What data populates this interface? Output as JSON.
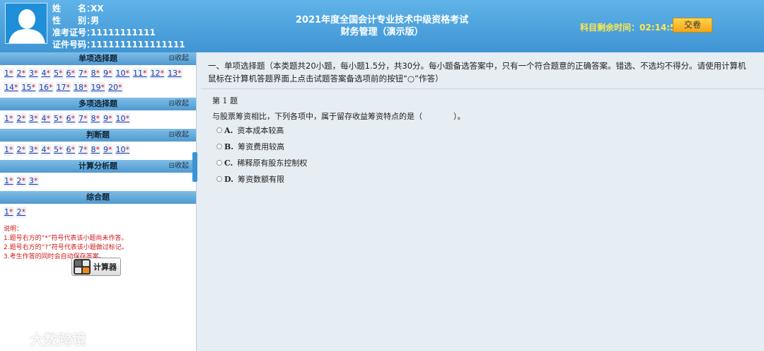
{
  "candidate": {
    "name_label": "姓　　名：",
    "name": "XX",
    "gender_label": "性　　别：",
    "gender": "男",
    "ticket_label": "准考证号：",
    "ticket": "11111111111",
    "id_label": "证件号码：",
    "id": "1111111111111111"
  },
  "exam": {
    "title": "2021年度全国会计专业技术中级资格考试",
    "subject": "财务管理（演示版）"
  },
  "timer": {
    "label": "科目剩余时间：",
    "value": "02:14:51"
  },
  "submit_label": "交卷",
  "sections": [
    {
      "title": "单项选择题",
      "collapse": "收起",
      "questions": [
        "1",
        "2",
        "3",
        "4",
        "5",
        "6",
        "7",
        "8",
        "9",
        "10",
        "11",
        "12",
        "13",
        "14",
        "15",
        "16",
        "17",
        "18",
        "19",
        "20"
      ]
    },
    {
      "title": "多项选择题",
      "collapse": "收起",
      "questions": [
        "1",
        "2",
        "3",
        "4",
        "5",
        "6",
        "7",
        "8",
        "9",
        "10"
      ]
    },
    {
      "title": "判断题",
      "collapse": "收起",
      "questions": [
        "1",
        "2",
        "3",
        "4",
        "5",
        "6",
        "7",
        "8",
        "9",
        "10"
      ]
    },
    {
      "title": "计算分析题",
      "collapse": "收起",
      "questions": [
        "1",
        "2",
        "3"
      ]
    },
    {
      "title": "综合题",
      "collapse": "",
      "questions": [
        "1",
        "2"
      ]
    }
  ],
  "star_mark": "*",
  "notes": {
    "title": "说明：",
    "lines": [
      "1.题号右方的“*”符号代表该小题尚未作答。",
      "2.题号右方的“?”符号代表该小题做过标记。",
      "3.考生作答的同时会自动保存答案。"
    ]
  },
  "calculator_label": "计算器",
  "watermark": "大数跨境",
  "instructions": "一、单项选择题（本类题共20小题，每小题1.5分，共30分。每小题备选答案中，只有一个符合题意的正确答案。错选、不选均不得分。请使用计算机鼠标在计算机答题界面上点击试题答案备选项前的按钮“○”作答）",
  "question": {
    "number": "第 1 题",
    "text": "与股票筹资相比，下列各项中，属于留存收益筹资特点的是（　　　　）。",
    "options": [
      {
        "letter": "A.",
        "text": "资本成本较高"
      },
      {
        "letter": "B.",
        "text": "筹资费用较高"
      },
      {
        "letter": "C.",
        "text": "稀释原有股东控制权"
      },
      {
        "letter": "D.",
        "text": "筹资数额有限"
      }
    ]
  }
}
